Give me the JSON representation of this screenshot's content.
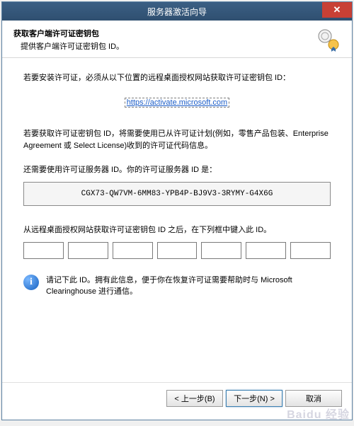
{
  "window": {
    "title": "服务器激活向导",
    "close_glyph": "✕"
  },
  "header": {
    "title": "获取客户端许可证密钥包",
    "subtitle": "提供客户端许可证密钥包 ID。"
  },
  "body": {
    "install_text": "若要安装许可证，必须从以下位置的远程桌面授权网站获取许可证密钥包 ID：",
    "link_text": "https://activate.microsoft.com",
    "link_href": "https://activate.microsoft.com",
    "obtain_text": "若要获取许可证密钥包 ID，将需要使用已从许可证计划(例如，零售产品包装、Enterprise Agreement 或 Select License)收到的许可证代码信息。",
    "server_id_label": "还需要使用许可证服务器 ID。你的许可证服务器 ID 是：",
    "server_id_value": "CGX73-QW7VM-6MM83-YPB4P-BJ9V3-3RYMY-G4X6G",
    "enter_id_label": "从远程桌面授权网站获取许可证密钥包 ID 之后，在下列框中键入此 ID。",
    "key_inputs": [
      "",
      "",
      "",
      "",
      "",
      "",
      ""
    ],
    "info_glyph": "i",
    "note_text": "请记下此 ID。拥有此信息，便于你在恢复许可证需要帮助时与 Microsoft Clearinghouse 进行通信。"
  },
  "footer": {
    "back": "< 上一步(B)",
    "next": "下一步(N) >",
    "cancel": "取消"
  },
  "watermark": "Baidu 经验"
}
